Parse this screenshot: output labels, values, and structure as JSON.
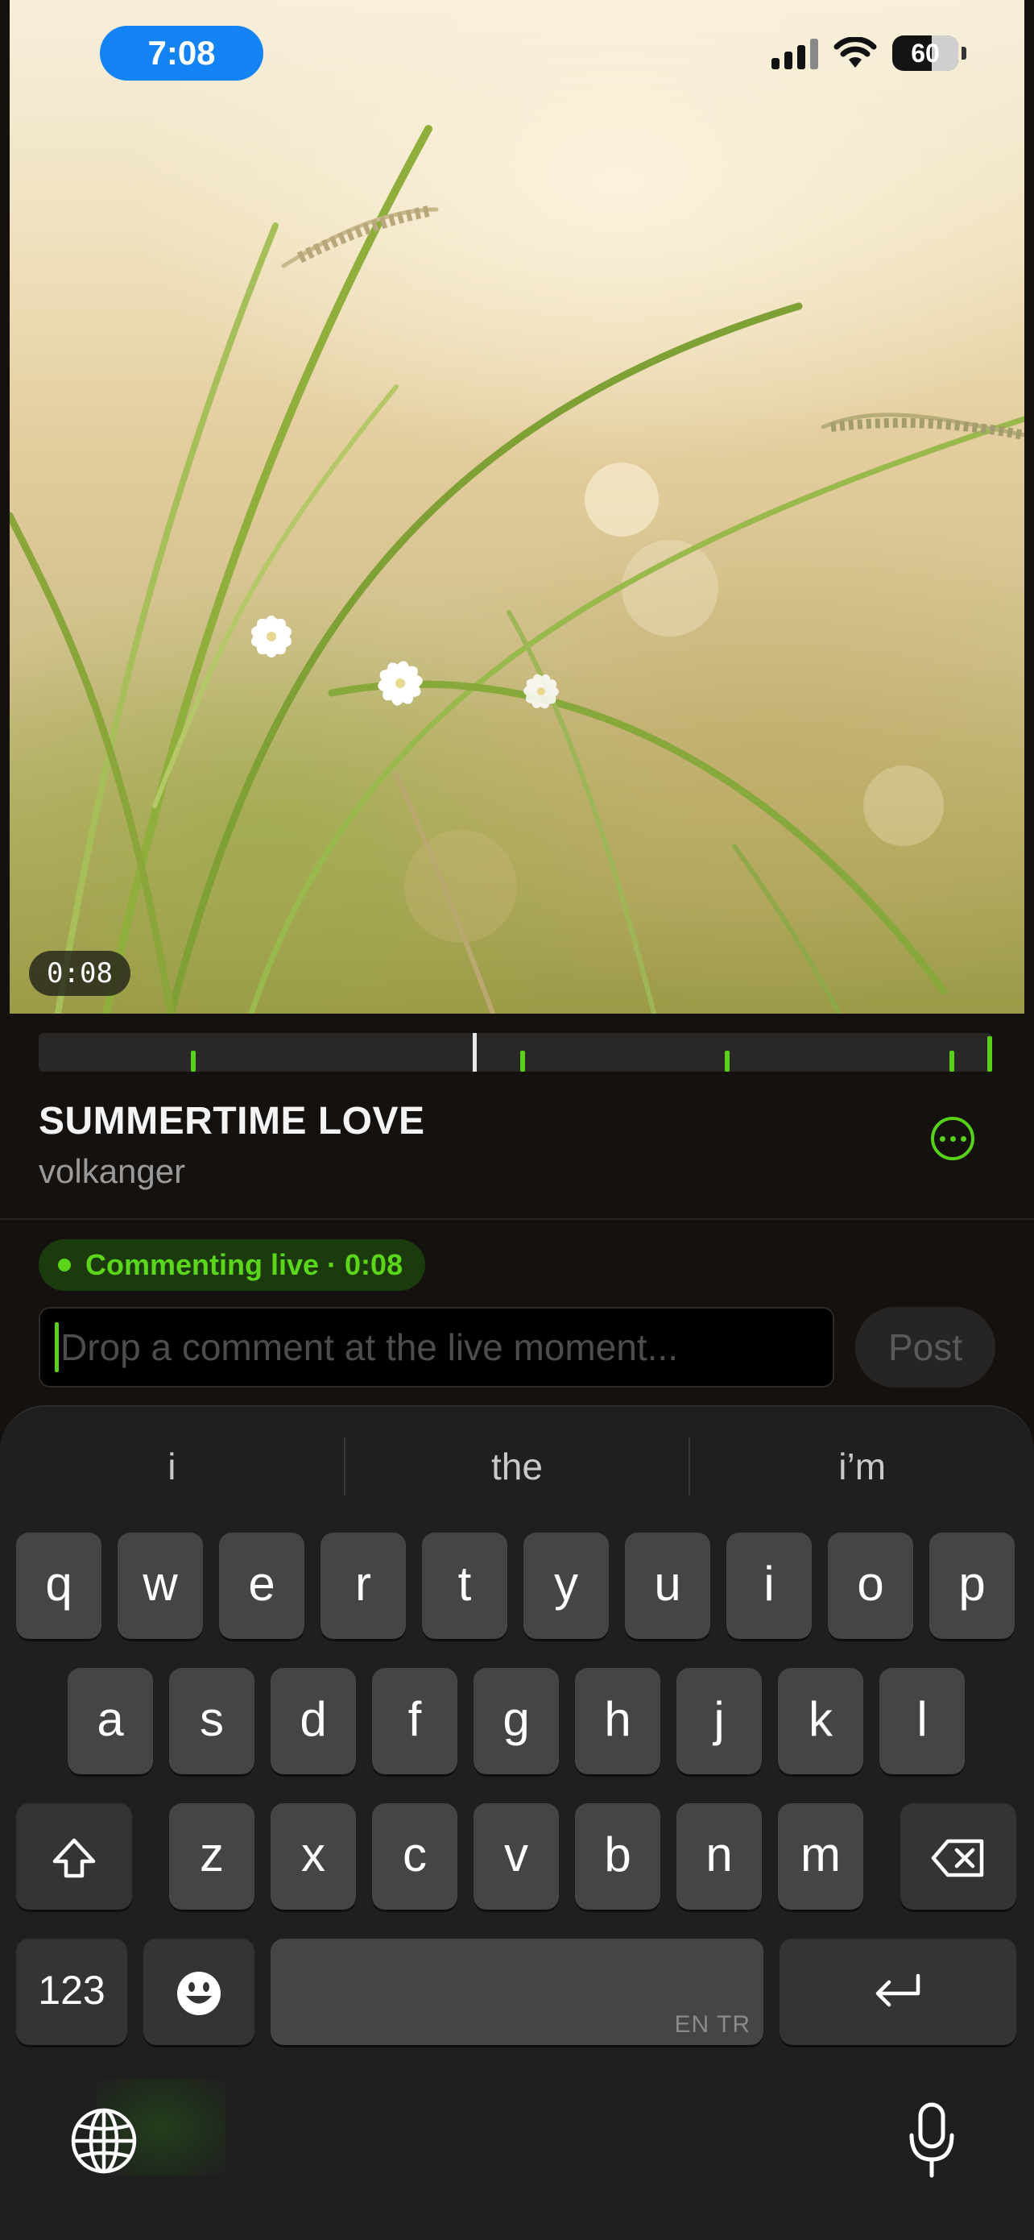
{
  "status_bar": {
    "time": "7:08",
    "battery": "60",
    "icons": [
      "cellular-signal-icon",
      "wifi-icon",
      "battery-icon"
    ]
  },
  "video": {
    "current_time": "0:08"
  },
  "timeline": {
    "playhead_fraction": 0.455,
    "marker_fractions": [
      0.16,
      0.505,
      0.72,
      0.955,
      0.999
    ]
  },
  "track": {
    "title": "SUMMERTIME LOVE",
    "artist": "volkanger",
    "more_icon": "more-options-icon"
  },
  "live": {
    "label": "Commenting live · 0:08"
  },
  "comment": {
    "placeholder": "Drop a comment at the live moment...",
    "post_label": "Post"
  },
  "keyboard": {
    "suggestions": [
      "i",
      "the",
      "i’m"
    ],
    "row1": [
      "q",
      "w",
      "e",
      "r",
      "t",
      "y",
      "u",
      "i",
      "o",
      "p"
    ],
    "row2": [
      "a",
      "s",
      "d",
      "f",
      "g",
      "h",
      "j",
      "k",
      "l"
    ],
    "row3": [
      "z",
      "x",
      "c",
      "v",
      "b",
      "n",
      "m"
    ],
    "numbers_label": "123",
    "space_hint": "EN TR",
    "icons": [
      "shift-icon",
      "delete-icon",
      "emoji-icon",
      "return-icon",
      "globe-icon",
      "microphone-icon"
    ]
  },
  "colors": {
    "accent": "#58d11a",
    "time_pill": "#1483f5",
    "background": "#15110e"
  }
}
